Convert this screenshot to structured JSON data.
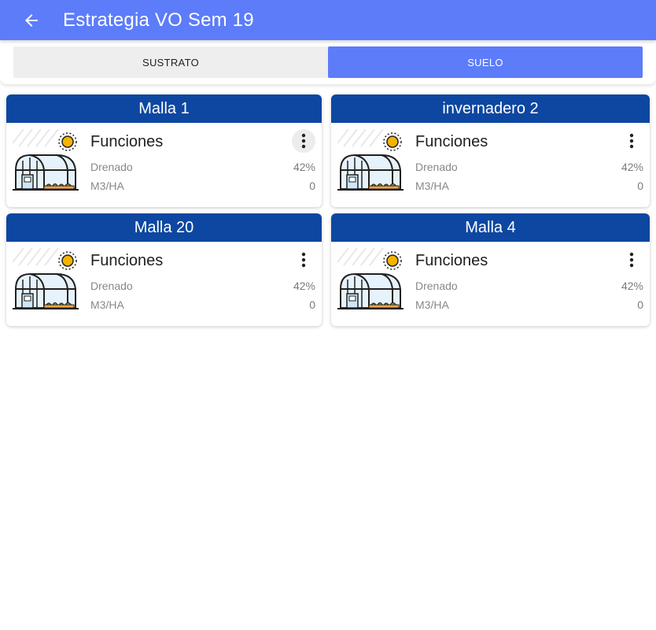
{
  "appbar": {
    "title": "Estrategia VO Sem 19",
    "back_icon": "arrow-left-icon"
  },
  "tabs": [
    {
      "label": "SUSTRATO",
      "active": false
    },
    {
      "label": "SUELO",
      "active": true
    }
  ],
  "cards": [
    {
      "name": "Malla 1",
      "title": "Funciones",
      "rows": [
        {
          "label": "Drenado",
          "value": "42%"
        },
        {
          "label": "M3/HA",
          "value": "0"
        }
      ]
    },
    {
      "name": "invernadero 2",
      "title": "Funciones",
      "rows": [
        {
          "label": "Drenado",
          "value": "42%"
        },
        {
          "label": "M3/HA",
          "value": "0"
        }
      ]
    },
    {
      "name": "Malla 20",
      "title": "Funciones",
      "rows": [
        {
          "label": "Drenado",
          "value": "42%"
        },
        {
          "label": "M3/HA",
          "value": "0"
        }
      ]
    },
    {
      "name": "Malla 4",
      "title": "Funciones",
      "rows": [
        {
          "label": "Drenado",
          "value": "42%"
        },
        {
          "label": "M3/HA",
          "value": "0"
        }
      ]
    }
  ],
  "colors": {
    "appbar": "#5c7cfa",
    "card_header": "#0d47a1",
    "tab_active": "#5c7cfa",
    "tab_inactive": "#eeeeee"
  }
}
